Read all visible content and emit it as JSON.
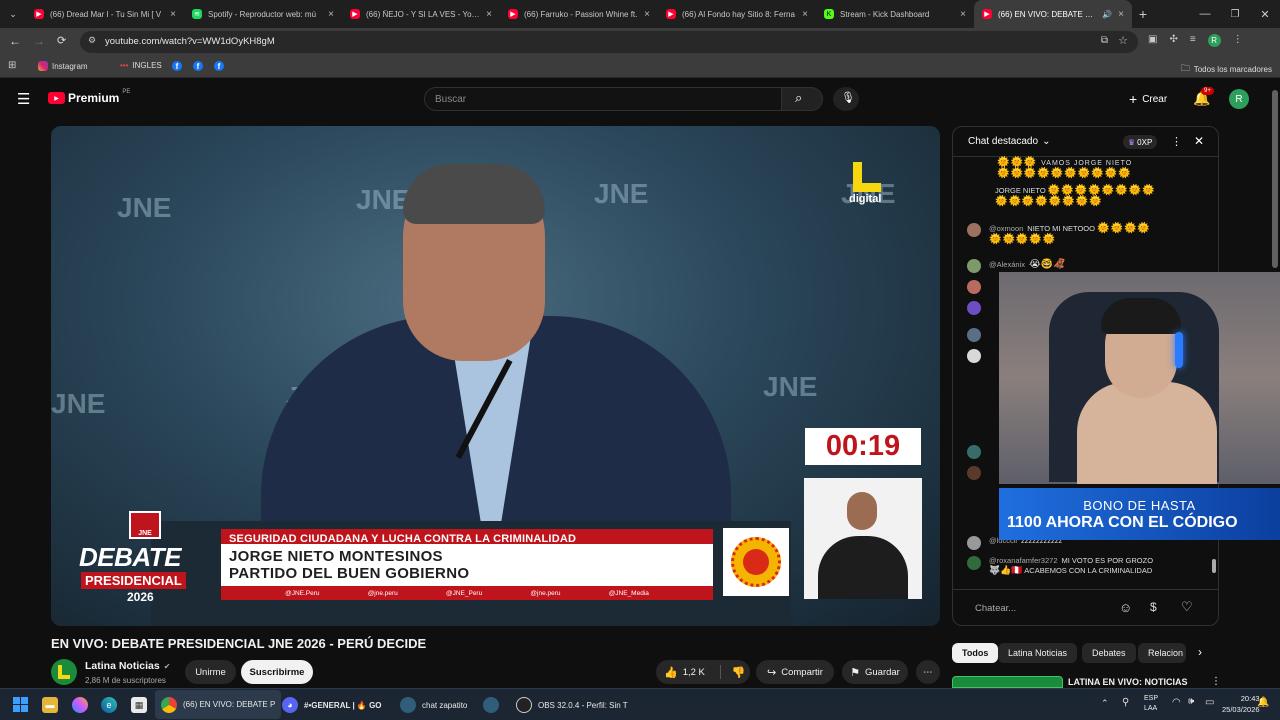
{
  "browser": {
    "tabs": [
      {
        "label": "(66) Dread Mar I - Tu Sin Mi [ V",
        "favicon": "youtube-icon",
        "color": "#ff0033"
      },
      {
        "label": "Spotify - Reproductor web: mú",
        "favicon": "spotify-icon",
        "color": "#1ed760"
      },
      {
        "label": "(66) ÑEJO - Y SI LA VES - YouTu",
        "favicon": "youtube-icon",
        "color": "#ff0033"
      },
      {
        "label": "(66) Farruko - Passion Whine ft.",
        "favicon": "youtube-icon",
        "color": "#ff0033"
      },
      {
        "label": "(66) Al Fondo hay Sitio 8: Ferna",
        "favicon": "youtube-icon",
        "color": "#ff0033"
      },
      {
        "label": "Stream - Kick Dashboard",
        "favicon": "kick-icon",
        "color": "#53fc18"
      },
      {
        "label": "(66) EN VIVO: DEBATE PRES",
        "favicon": "youtube-icon",
        "color": "#ff0033",
        "active": true
      }
    ],
    "url": "youtube.com/watch?v=WW1dOyKH8gM",
    "bookmarks": {
      "instagram": "Instagram",
      "ingles": "INGLES",
      "all_bookmarks": "Todos los marcadores"
    }
  },
  "youtube": {
    "logo_text": "Premium",
    "region": "PE",
    "search_placeholder": "Buscar",
    "create_label": "Crear",
    "notif_count": "9+",
    "avatar_letter": "R"
  },
  "video": {
    "watermarks": [
      "JNE",
      "JNE",
      "JNE",
      "JNE",
      "JNE",
      "JNE",
      "JNE"
    ],
    "digital_logo": "digital",
    "timer": "00:19",
    "logo_top": "JNE",
    "debate_word": "DEBATE",
    "presidencial_word": "PRESIDENCIAL",
    "year": "2026",
    "topic": "SEGURIDAD CIUDADANA Y LUCHA CONTRA LA CRIMINALIDAD",
    "candidate_name": "JORGE NIETO MONTESINOS",
    "party": "PARTIDO DEL BUEN GOBIERNO",
    "socials": [
      "@JNE.Peru",
      "@jne.peru",
      "@JNE_Peru",
      "@jne.peru",
      "@JNE_Media"
    ],
    "overlay_line1": "BONO DE HASTA",
    "overlay_line2": "1100 AHORA CON EL CÓDIGO"
  },
  "chat": {
    "header": "Chat destacado",
    "points": "0XP",
    "messages": [
      {
        "user": "",
        "text": "VAMOS JORGE NIETO"
      },
      {
        "user": "",
        "text": "JORGE NIETO"
      },
      {
        "user": "@oxmoon",
        "text": "NIETO MI NETOOO"
      },
      {
        "user": "@Alexánix",
        "text": ""
      },
      {
        "user": "@lucccii",
        "text": "zzzzzzzzzzz"
      },
      {
        "user": "@roxanafamfer3272",
        "text": "MI VOTO ES POR GROZO"
      },
      {
        "user": "",
        "text": "ACABEMOS CON LA CRIMINALIDAD"
      }
    ],
    "input_placeholder": "Chatear..."
  },
  "watch": {
    "title": "EN VIVO: DEBATE PRESIDENCIAL JNE 2026 - PERÚ DECIDE",
    "channel": "Latina Noticias",
    "subscribers": "2,86 M de suscriptores",
    "join_label": "Unirme",
    "subscribe_label": "Suscribirme",
    "likes": "1,2 K",
    "share_label": "Compartir",
    "save_label": "Guardar",
    "filters": [
      "Todos",
      "Latina Noticias",
      "Debates",
      "Relacion"
    ],
    "related_title": "LATINA EN VIVO: NOTICIAS"
  },
  "taskbar": {
    "chrome_title": "(66) EN VIVO: DEBATE P",
    "discord_title": "#•GENERAL | 🔥 GO",
    "zapatito": "chat zapatito",
    "obs": "OBS 32.0.4 - Perfil: Sin T",
    "lang_top": "ESP",
    "lang_bottom": "LAA",
    "time": "20:43",
    "date": "25/03/2026"
  }
}
